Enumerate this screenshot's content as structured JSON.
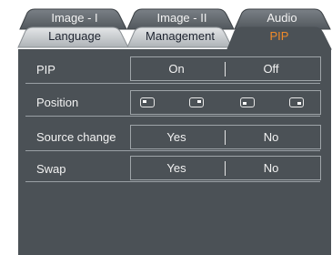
{
  "tabs_back": [
    {
      "label": "Image - I"
    },
    {
      "label": "Image - II"
    },
    {
      "label": "Audio"
    }
  ],
  "tabs_front": [
    {
      "label": "Language"
    },
    {
      "label": "Management"
    },
    {
      "label": "PIP"
    }
  ],
  "rows": {
    "pip": {
      "label": "PIP",
      "options": [
        "On",
        "Off"
      ]
    },
    "position": {
      "label": "Position",
      "icons": [
        "position-top-left-icon",
        "position-top-right-icon",
        "position-bottom-left-icon",
        "position-bottom-right-icon"
      ]
    },
    "source_change": {
      "label": "Source change",
      "options": [
        "Yes",
        "No"
      ]
    },
    "swap": {
      "label": "Swap",
      "options": [
        "Yes",
        "No"
      ]
    }
  },
  "colors": {
    "panel": "#4b5156",
    "active_tab_text": "#f08a2a",
    "back_tab": "#5e6469",
    "front_tab": "#c5c9cc"
  }
}
